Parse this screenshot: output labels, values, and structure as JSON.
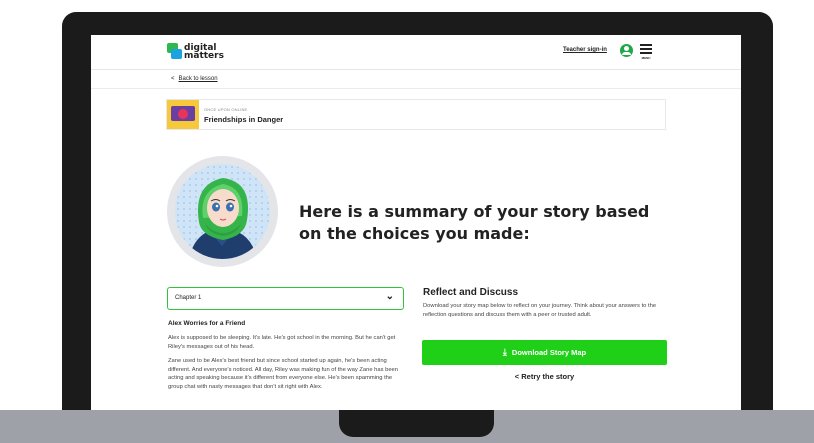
{
  "header": {
    "logo_line1": "digital",
    "logo_line2": "matters",
    "teacher_signin": "Teacher sign-in",
    "menu_label": "MENU"
  },
  "nav": {
    "back_chevron": "<",
    "back_label": "Back to lesson"
  },
  "lesson": {
    "kicker": "ONCE UPON ONLINE",
    "title": "Friendships in Danger"
  },
  "summary": {
    "headline": "Here is a summary of your story based on the choices you made:"
  },
  "story": {
    "chapter_select": "Chapter 1",
    "chapter_chevron": "⌄",
    "chapter_title": "Alex Worries for a Friend",
    "paragraphs": [
      "Alex is supposed to be sleeping. It's late. He's got school in the morning. But he can't get Riley's messages out of his head.",
      "Zane used to be Alex's best friend but since school started up again, he's been acting different. And everyone's noticed. All day, Riley was making fun of the way Zane has been acting and speaking because it's different from everyone else. He's been spamming the group chat with nasty messages that don't sit right with Alex."
    ]
  },
  "reflect": {
    "heading": "Reflect and Discuss",
    "text": "Download your story map below to reflect on your journey. Think about your answers to the reflection questions and discuss them with a peer or trusted adult.",
    "download_label": "Download Story Map",
    "download_icon": "⤓",
    "retry_chevron": "<",
    "retry_label": "Retry the story"
  },
  "icons": {
    "user": "user-circle-icon",
    "menu": "hamburger-menu-icon",
    "download": "download-icon",
    "chevron_down": "chevron-down-icon"
  },
  "colors": {
    "brand_green": "#20cf18",
    "select_border": "#2fc23a",
    "user_icon": "#1fa84a",
    "laptop_bezel": "#1b1b1b",
    "laptop_base": "#9ea1a7"
  }
}
